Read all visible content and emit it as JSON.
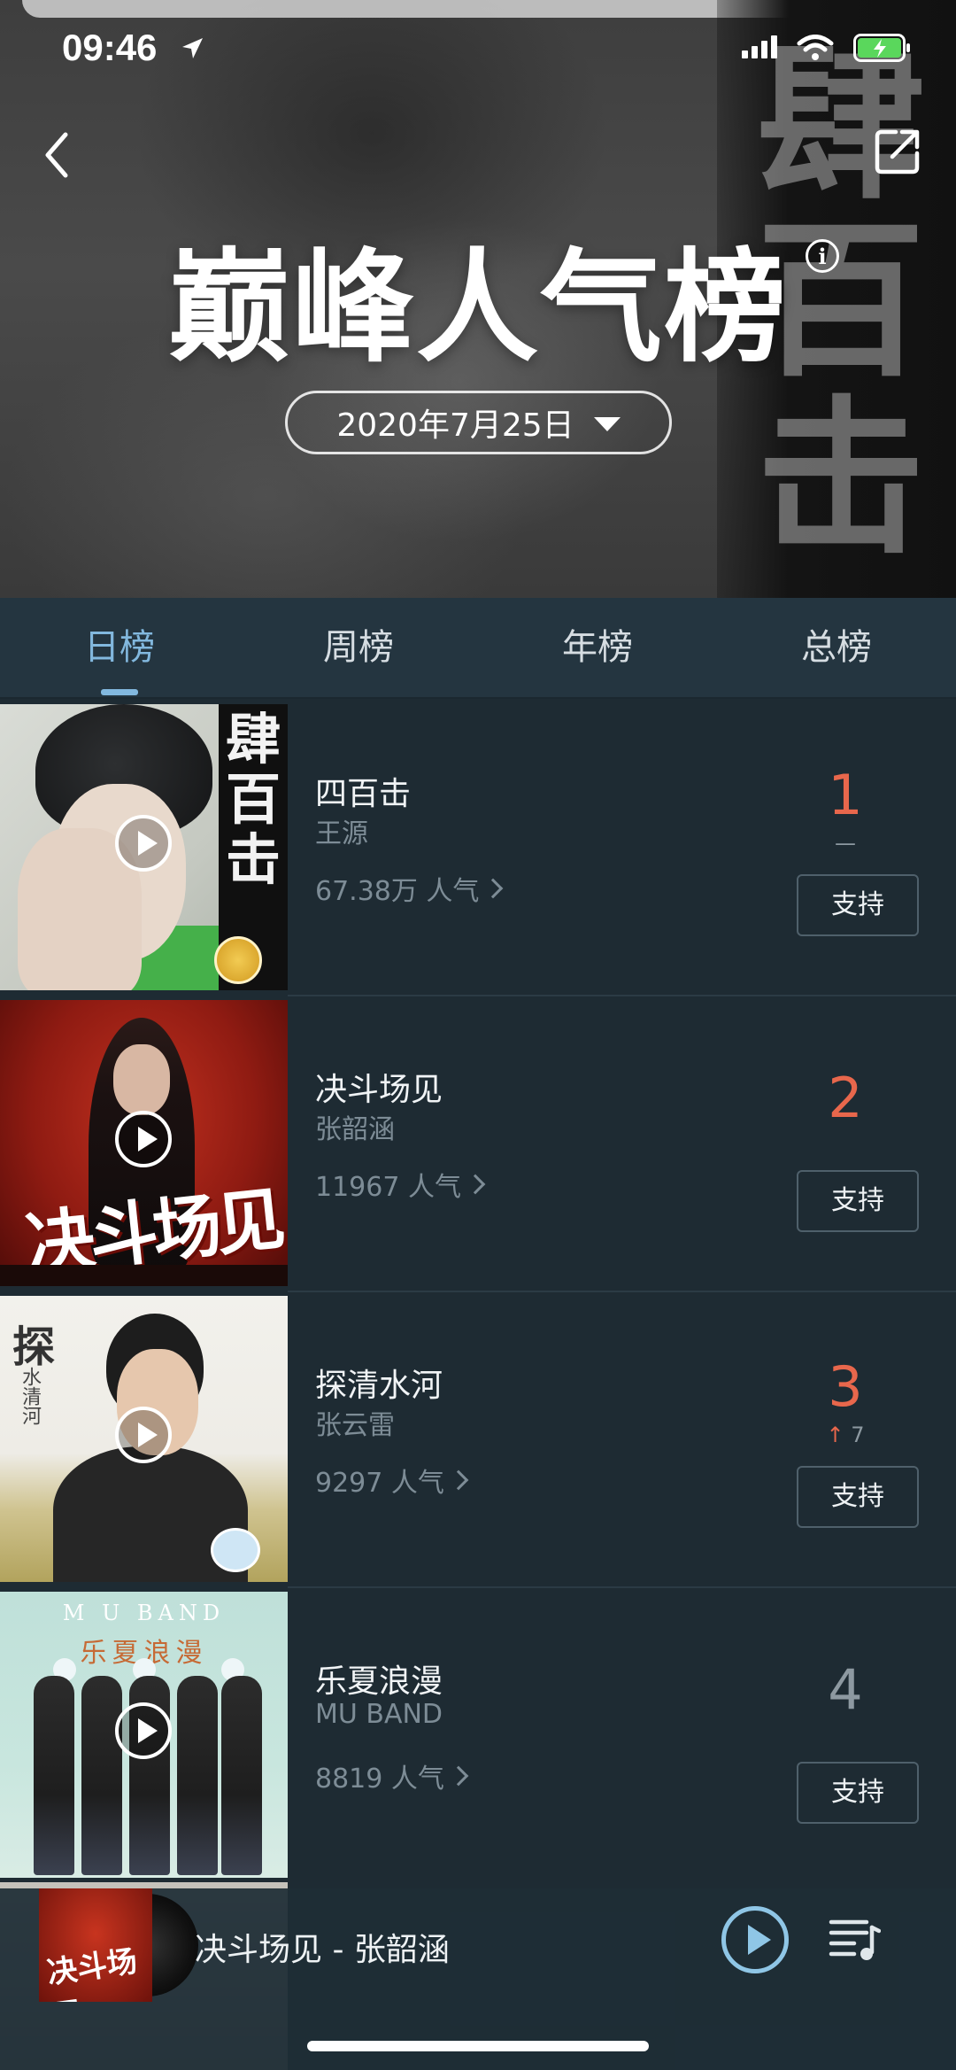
{
  "status_bar": {
    "time": "09:46"
  },
  "header": {
    "title": "巅峰人气榜",
    "date": "2020年7月25日",
    "hero_art_text": "肆百击"
  },
  "tabs": [
    {
      "label": "日榜",
      "active": true
    },
    {
      "label": "周榜",
      "active": false
    },
    {
      "label": "年榜",
      "active": false
    },
    {
      "label": "总榜",
      "active": false
    }
  ],
  "songs": [
    {
      "rank": "1",
      "change": "—",
      "title": "四百击",
      "artist": "王源",
      "popularity": "67.38万 人气",
      "support_label": "支持",
      "cover_text": "肆百击"
    },
    {
      "rank": "2",
      "change": "",
      "title": "决斗场见",
      "artist": "张韶涵",
      "popularity": "11967 人气",
      "support_label": "支持",
      "cover_text": "决斗场见"
    },
    {
      "rank": "3",
      "change_arrow": "↑",
      "change": "7",
      "title": "探清水河",
      "artist": "张云雷",
      "popularity": "9297 人气",
      "support_label": "支持",
      "cover_text": "探",
      "cover_subtext": "水清河"
    },
    {
      "rank": "4",
      "change": "",
      "title": "乐夏浪漫",
      "artist": "MU BAND",
      "popularity": "8819 人气",
      "support_label": "支持",
      "cover_band": "M U BAND",
      "cover_text": "乐夏浪漫"
    }
  ],
  "player": {
    "now_playing": "决斗场见 - 张韶涵",
    "cover_text": "决斗场见"
  },
  "colors": {
    "rank_accent": "#e8674c",
    "tab_active": "#82b8de",
    "background": "#1e2b33"
  }
}
